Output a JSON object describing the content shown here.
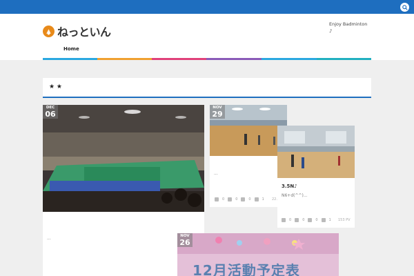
{
  "topbar": {
    "search_icon": "search-icon",
    "color": "#1e6ebf"
  },
  "header": {
    "logo_text": "ねっといん",
    "logo_icon": "badminton-shuttle-icon",
    "tagline_line1": "Enjoy Badminton",
    "tagline_line2": "♪"
  },
  "nav": {
    "home_label": "Home"
  },
  "stripe_colors": [
    "#2aa8e0",
    "#f0a030",
    "#e0407a",
    "#8a5ab8",
    "#2aa8e0",
    "#20b0c0"
  ],
  "page_title": "★ ★",
  "posts": [
    {
      "month": "DEC",
      "day": "06",
      "excerpt": "..."
    },
    {
      "month": "NOV",
      "day": "29",
      "excerpt": "...",
      "stats": [
        "0",
        "0",
        "0",
        "1"
      ],
      "pv": "22..."
    },
    {
      "title": "3.5N♪",
      "excerpt": "N6+d(^^)...",
      "stats": [
        "0",
        "0",
        "0",
        "1"
      ],
      "pv": "153 PV"
    },
    {
      "month": "NOV",
      "day": "26",
      "image_text": "12月活動予定表"
    }
  ]
}
